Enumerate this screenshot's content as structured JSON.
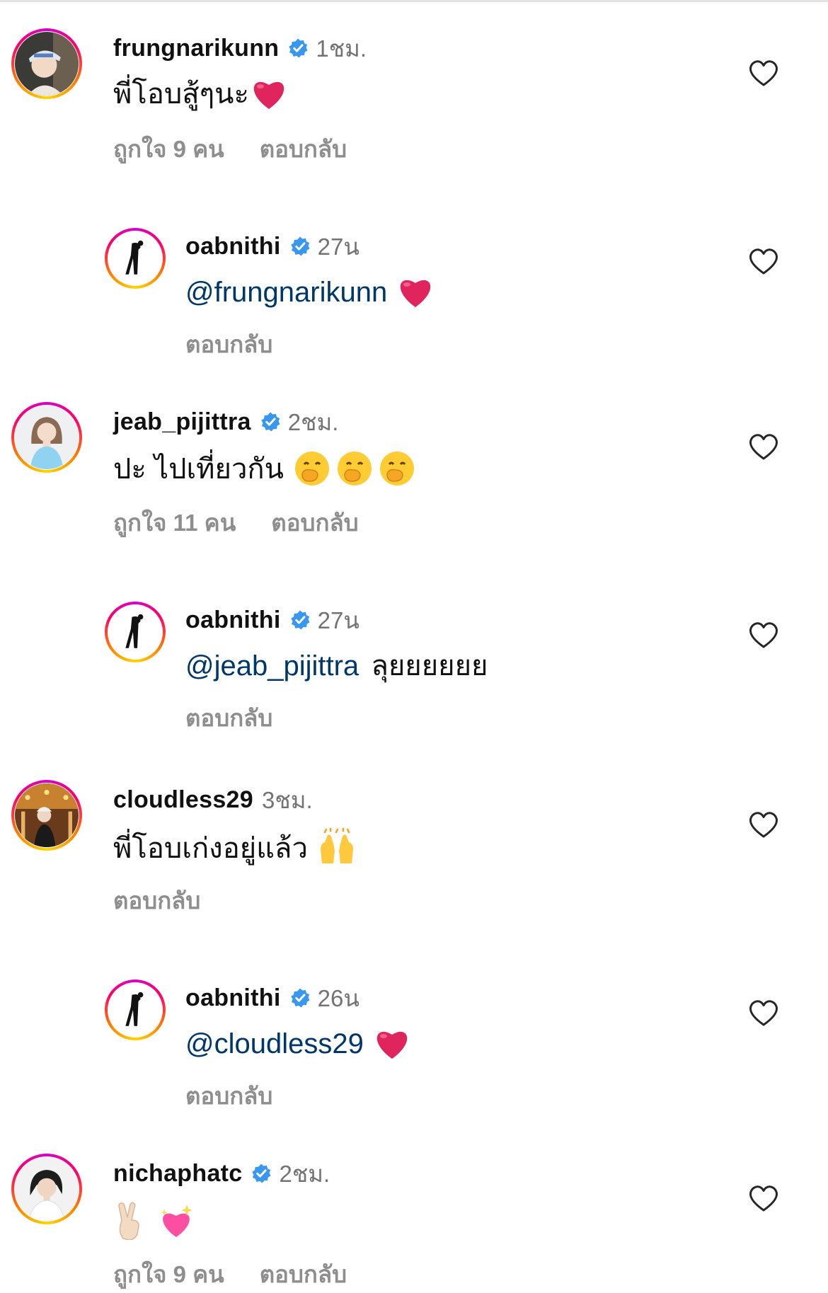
{
  "comments": [
    {
      "username": "frungnarikunn",
      "time": "1ชม.",
      "text": "พี่โอบสู้ๆนะ",
      "likes": "ถูกใจ 9 คน",
      "reply_label": "ตอบกลับ",
      "avatar": "woman-with-cap-photo"
    },
    {
      "username": "oabnithi",
      "time": "27น",
      "mention": "@frungnarikunn",
      "text": "",
      "reply_label": "ตอบกลับ",
      "avatar": "bowing-figure-photo"
    },
    {
      "username": "jeab_pijittra",
      "time": "2ชม.",
      "text": "ปะ ไปเที่ยวกัน",
      "likes": "ถูกใจ 11 คน",
      "reply_label": "ตอบกลับ",
      "avatar": "woman-in-blue-photo"
    },
    {
      "username": "oabnithi",
      "time": "27น",
      "mention": "@jeab_pijittra",
      "text": "ลุยยยยยย",
      "reply_label": "ตอบกลับ",
      "avatar": "bowing-figure-photo"
    },
    {
      "username": "cloudless29",
      "time": "3ชม.",
      "text": "พี่โอบเก่งอยู่แล้ว",
      "reply_label": "ตอบกลับ",
      "avatar": "carousel-photo"
    },
    {
      "username": "oabnithi",
      "time": "26น",
      "mention": "@cloudless29",
      "text": "",
      "reply_label": "ตอบกลับ",
      "avatar": "bowing-figure-photo"
    },
    {
      "username": "nichaphatc",
      "time": "2ชม.",
      "text": "",
      "likes": "ถูกใจ 9 คน",
      "reply_label": "ตอบกลับ",
      "avatar": "woman-portrait-photo"
    }
  ],
  "colors": {
    "username": "#111111",
    "meta": "#8e8e8e",
    "mention": "#00376b",
    "verified": "#3897f0",
    "heart_outline": "#8e8e8e",
    "heart_emoji": "#e0245e"
  }
}
